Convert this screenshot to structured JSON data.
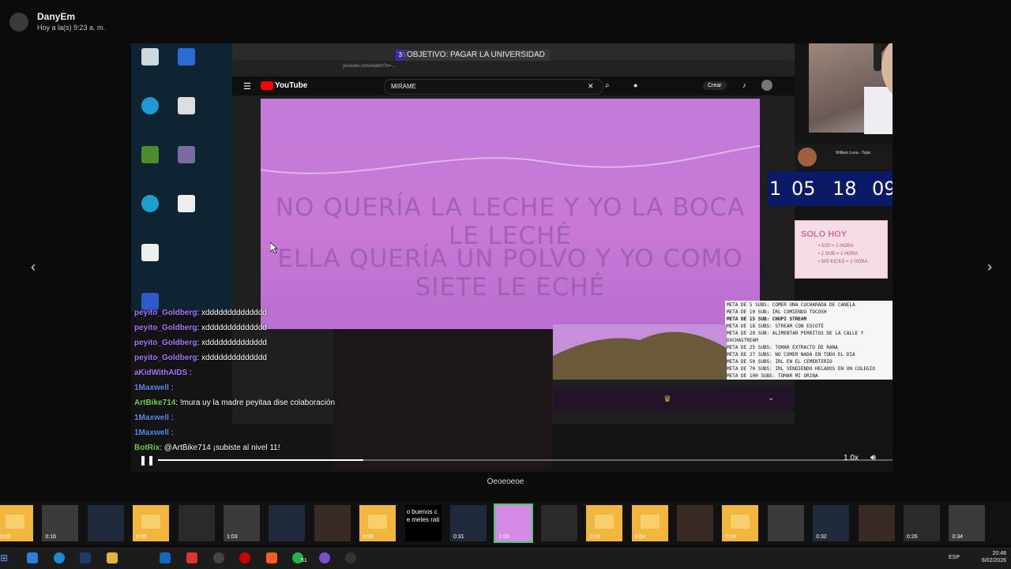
{
  "header": {
    "sender_name": "DanyEm   ",
    "sender_time": "Hoy a la(s) 9:23 a. m."
  },
  "navigation": {
    "prev_icon": "‹",
    "next_icon": "›"
  },
  "stream": {
    "objective_badge": "35",
    "objective_text": "OBJETIVO: PAGAR LA UNIVERSIDAD",
    "url": "youtube.com/watch?v=...",
    "youtube_label": "YouTube",
    "search_value": "MIRAME",
    "create_label": "Crear",
    "lyrics": [
      "NO QUERÍA LA LECHE Y YO LA BOCA LE LECHÉ",
      "ELLA QUERÍA UN POLVO Y YO COMO SIETE LE ECHÉ"
    ],
    "now_playing": "William Luna - Topic",
    "countdown": [
      "1",
      "05",
      "18",
      "09"
    ],
    "promo": {
      "title": "SOLO HOY",
      "lines": [
        "• 5/20 = 1 HORA",
        "• 1 SUB = 1 HORA",
        "• 500 KICKS = 1 HORA"
      ]
    },
    "goals": [
      "META DE 5 SUBS: COMER UNA CUCHARADA DE CANELA",
      "META DE 10 SUB: IRL COMIENDO TOCOSH",
      "META DE 15 SUB: CHUPI STREAM",
      "META DE 18 SUBS: STREAM CON ESCOTE",
      "META DE 20 SUB: ALIMENTAR PERRITOS DE LA CALLE Y",
      "DUCHASTREAM",
      "META DE 25 SUBS: TOMAR EXTRACTO DE RANA",
      "META DE 27 SUBS: NO COMER NADA EN TODO EL DIA",
      "META DE 50 SUBS: IRL EN EL CEMENTERIO",
      "META DE 70 SUBS: IRL VENDIENDO HELADOS EN UN COLEGIO",
      "META DE 100 SUBS: TOMAR MI ORINA"
    ],
    "chat": [
      {
        "user": "peyito_Goldberg",
        "msg": ": xdddddddddddddd",
        "color": "#a874ff"
      },
      {
        "user": "peyito_Goldberg",
        "msg": ": xdddddddddddddd",
        "color": "#a874ff"
      },
      {
        "user": "peyito_Goldberg",
        "msg": ": xdddddddddddddd",
        "color": "#a874ff"
      },
      {
        "user": "peyito_Goldberg",
        "msg": ": xdddddddddddddd",
        "color": "#a874ff"
      },
      {
        "user": "aKidWithAIDS",
        "msg": " :",
        "color": "#a874ff"
      },
      {
        "user": "1Maxwell",
        "msg": " :",
        "color": "#5b8df0"
      },
      {
        "user": "ArtBike714",
        "msg": ": !mura uy la madre peyitaa dise colaboración",
        "color": "#6ad24e"
      },
      {
        "user": "1Maxwell",
        "msg": " :",
        "color": "#5b8df0"
      },
      {
        "user": "1Maxwell",
        "msg": " :",
        "color": "#5b8df0"
      },
      {
        "user": "BotRix",
        "msg": ": @ArtBike714 ¡subiste al nivel 11!",
        "color": "#6ad24e"
      }
    ],
    "playback_speed": "1.0x",
    "progress": 0.28
  },
  "caption": "Oeoeoeoe",
  "thumbnails": [
    {
      "meta": "0:03",
      "kind": "folder"
    },
    {
      "meta": "0:16",
      "kind": "dark"
    },
    {
      "meta": "",
      "kind": "dark"
    },
    {
      "meta": "0:06",
      "kind": "folder"
    },
    {
      "meta": "",
      "kind": "dark"
    },
    {
      "meta": "1:03",
      "kind": "dark"
    },
    {
      "meta": "",
      "kind": "dark"
    },
    {
      "meta": "",
      "kind": "dark"
    },
    {
      "meta": "0:09",
      "kind": "folder"
    },
    {
      "meta": "",
      "kind": "text",
      "text": "o buenos c\ne metes rati"
    },
    {
      "meta": "0:31",
      "kind": "dark"
    },
    {
      "meta": "1:02",
      "kind": "pink",
      "selected": true
    },
    {
      "meta": "",
      "kind": "dark"
    },
    {
      "meta": "0:19",
      "kind": "folder"
    },
    {
      "meta": "0:04",
      "kind": "folder"
    },
    {
      "meta": "",
      "kind": "dark"
    },
    {
      "meta": "0:14",
      "kind": "folder"
    },
    {
      "meta": "",
      "kind": "dark"
    },
    {
      "meta": "0:32",
      "kind": "dark"
    },
    {
      "meta": "",
      "kind": "dark"
    },
    {
      "meta": "0:26",
      "kind": "dark"
    },
    {
      "meta": "0:34",
      "kind": "dark"
    }
  ],
  "taskbar": {
    "badge": "51",
    "lang": "ESP",
    "time": "20:48",
    "date": "6/02/2026"
  },
  "colors": {
    "accent_green": "#3ad06e",
    "yt_red": "#ff0000",
    "purple_bg": "#c27bd8"
  }
}
